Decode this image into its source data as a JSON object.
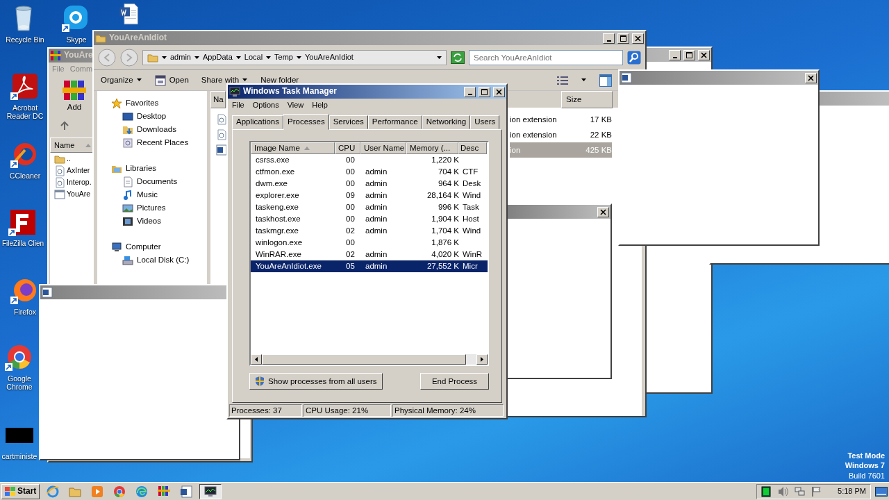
{
  "desktop_icons": [
    {
      "label": "Recycle Bin",
      "kind": "bin"
    },
    {
      "label": "Skype",
      "kind": "skype"
    },
    {
      "kind": "word"
    },
    {
      "label": "Acrobat Reader DC",
      "kind": "acrobat"
    },
    {
      "label": "CCleaner",
      "kind": "ccleaner"
    },
    {
      "label": "FileZilla Clien",
      "kind": "filezilla"
    },
    {
      "label": "Firefox",
      "kind": "firefox"
    },
    {
      "label": "Google Chrome",
      "kind": "chrome"
    },
    {
      "label": "cartministe",
      "kind": "black"
    }
  ],
  "winrar": {
    "title": "YouAre",
    "menu": [
      "File",
      "Comm"
    ],
    "add_button": "Add",
    "list_header": "Name",
    "rows": [
      {
        "name": "..",
        "kind": "folder"
      },
      {
        "name": "AxInter",
        "kind": "dll"
      },
      {
        "name": "Interop.",
        "kind": "dll"
      },
      {
        "name": "YouAre",
        "kind": "exe"
      }
    ]
  },
  "explorer": {
    "title": "YouAreAnIdiot",
    "breadcrumb": [
      "admin",
      "AppData",
      "Local",
      "Temp",
      "YouAreAnIdiot"
    ],
    "search": {
      "placeholder": "Search YouAreAnIdiot"
    },
    "toolbar": [
      {
        "label": "Organize",
        "kind": "menu"
      },
      {
        "label": "Open",
        "kind": "open"
      },
      {
        "label": "Share with",
        "kind": "menu"
      },
      {
        "label": "New folder",
        "kind": "plain"
      }
    ],
    "nav": [
      {
        "label": "Favorites",
        "kind": "star",
        "children": [
          {
            "label": "Desktop",
            "kind": "desktop"
          },
          {
            "label": "Downloads",
            "kind": "downloads"
          },
          {
            "label": "Recent Places",
            "kind": "recent"
          }
        ]
      },
      {
        "label": "Libraries",
        "kind": "libraries",
        "children": [
          {
            "label": "Documents",
            "kind": "documents"
          },
          {
            "label": "Music",
            "kind": "music"
          },
          {
            "label": "Pictures",
            "kind": "pictures"
          },
          {
            "label": "Videos",
            "kind": "videos"
          }
        ]
      },
      {
        "label": "Computer",
        "kind": "computer",
        "children": [
          {
            "label": "Local Disk (C:)",
            "kind": "disk"
          }
        ]
      }
    ],
    "columns": [
      "Na",
      "Size"
    ],
    "files": [
      {
        "kind": "dll",
        "type": "ion extension",
        "size": "17 KB",
        "selected": false
      },
      {
        "kind": "dll",
        "type": "ion extension",
        "size": "22 KB",
        "selected": false
      },
      {
        "kind": "word",
        "type": "ion",
        "size": "425 KB",
        "selected": true
      }
    ]
  },
  "task_manager": {
    "title": "Windows Task Manager",
    "menu": [
      "File",
      "Options",
      "View",
      "Help"
    ],
    "tabs": [
      {
        "label": "Applications",
        "selected": false
      },
      {
        "label": "Processes",
        "selected": true
      },
      {
        "label": "Services",
        "selected": false
      },
      {
        "label": "Performance",
        "selected": false
      },
      {
        "label": "Networking",
        "selected": false
      },
      {
        "label": "Users",
        "selected": false
      }
    ],
    "columns": [
      "Image Name",
      "CPU",
      "User Name",
      "Memory (...",
      "Desc"
    ],
    "rows": [
      {
        "name": "csrss.exe",
        "cpu": "00",
        "memory": "1,220 K",
        "selected": false
      },
      {
        "name": "ctfmon.exe",
        "cpu": "00",
        "user": "admin",
        "memory": "704 K",
        "desc": "CTF",
        "selected": false
      },
      {
        "name": "dwm.exe",
        "cpu": "00",
        "user": "admin",
        "memory": "964 K",
        "desc": "Desk",
        "selected": false
      },
      {
        "name": "explorer.exe",
        "cpu": "09",
        "user": "admin",
        "memory": "28,164 K",
        "desc": "Wind",
        "selected": false
      },
      {
        "name": "taskeng.exe",
        "cpu": "00",
        "user": "admin",
        "memory": "996 K",
        "desc": "Task",
        "selected": false
      },
      {
        "name": "taskhost.exe",
        "cpu": "00",
        "user": "admin",
        "memory": "1,904 K",
        "desc": "Host",
        "selected": false
      },
      {
        "name": "taskmgr.exe",
        "cpu": "02",
        "user": "admin",
        "memory": "1,704 K",
        "desc": "Wind",
        "selected": false
      },
      {
        "name": "winlogon.exe",
        "cpu": "00",
        "memory": "1,876 K",
        "selected": false
      },
      {
        "name": "WinRAR.exe",
        "cpu": "02",
        "user": "admin",
        "memory": "4,020 K",
        "desc": "WinR",
        "selected": false
      },
      {
        "name": "YouAreAnIdiot.exe",
        "cpu": "05",
        "user": "admin",
        "memory": "27,552 K",
        "desc": "Micr",
        "selected": true
      }
    ],
    "show_all_button": "Show processes from all users",
    "end_button": "End Process",
    "status": [
      "Processes: 37",
      "CPU Usage: 21%",
      "Physical Memory: 24%"
    ]
  },
  "taskbar": {
    "start": "Start",
    "apps": [
      {
        "kind": "ie",
        "selected": false
      },
      {
        "kind": "folder",
        "selected": false
      },
      {
        "kind": "media",
        "selected": false
      },
      {
        "kind": "chrome",
        "selected": false
      },
      {
        "kind": "edge",
        "selected": false
      },
      {
        "kind": "winrar",
        "selected": false
      },
      {
        "kind": "word",
        "selected": false
      },
      {
        "kind": "taskmgr",
        "selected": true
      }
    ],
    "clock": "5:18 PM"
  },
  "test_mode": [
    "Test Mode",
    "Windows 7",
    "Build 7601"
  ]
}
